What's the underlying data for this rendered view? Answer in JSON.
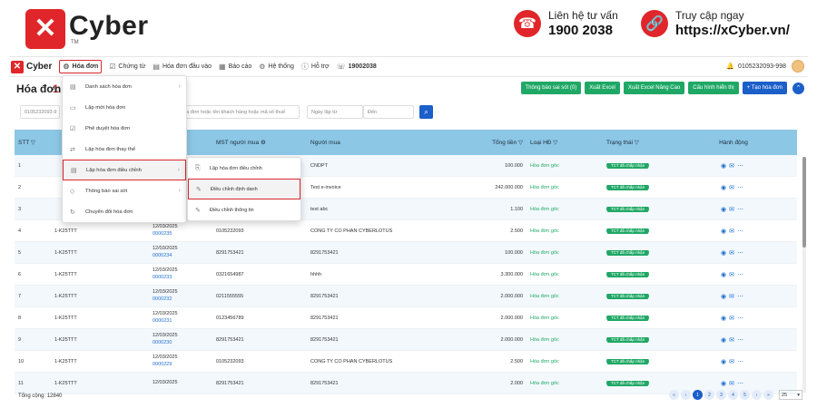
{
  "banner": {
    "brand": "Cyber",
    "tm": "TM",
    "hotline_label": "Liên hệ tư vấn",
    "hotline_number": "1900 2038",
    "site_label": "Truy cập ngay",
    "site_url": "https://xCyber.vn/"
  },
  "nav": {
    "brand": "Cyber",
    "items": [
      "Hóa đơn",
      "Chứng từ",
      "Hóa đơn đầu vào",
      "Báo cáo",
      "Hệ thống",
      "Hỗ trợ",
      "19002038"
    ],
    "account": "0105232093-998"
  },
  "markers": [
    "1",
    "2",
    "3"
  ],
  "page": {
    "title": "Hóa đơn",
    "tab": "cả",
    "buttons": [
      "Thông báo sai sót (0)",
      "Xuất Excel",
      "Xuất Excel Nâng Cao",
      "Cấu hình hiển thị",
      "+ Tạo hóa đơn"
    ]
  },
  "filters": {
    "tax_code": "0105232093-9",
    "search_placeholder": "hóa đơn hoặc tên khách hàng hoặc mã số thuế",
    "from_placeholder": "Ngày lập từ",
    "to_placeholder": "Đến"
  },
  "table": {
    "headers": [
      "STT",
      "",
      "lập",
      "MST người mua",
      "Người mua",
      "Tổng tiền",
      "Loại HĐ",
      "Trạng thái",
      "Hành động"
    ],
    "rows": [
      {
        "stt": "1",
        "kh": "",
        "date": "",
        "no": "",
        "mst": "",
        "buyer": "CNDPT",
        "total": "100.000",
        "type": "Hóa đơn gốc",
        "status": "TCT đã chấp nhận"
      },
      {
        "stt": "2",
        "kh": "",
        "date": "",
        "no": "",
        "mst": "",
        "buyer": "Test e-invoice",
        "total": "242.000.000",
        "type": "Hóa đơn gốc",
        "status": "TCT đã chấp nhận"
      },
      {
        "stt": "3",
        "kh": "",
        "date": "",
        "no": "",
        "mst": "",
        "buyer": "test abc",
        "total": "1.100",
        "type": "Hóa đơn gốc",
        "status": "TCT đã chấp nhận"
      },
      {
        "stt": "4",
        "kh": "1-K25TTT",
        "date": "12/03/2025",
        "no": "0000235",
        "mst": "0105232093",
        "buyer": "CÔNG TY CỔ PHẦN CYBERLOTUS",
        "total": "2.500",
        "type": "Hóa đơn gốc",
        "status": "TCT đã chấp nhận"
      },
      {
        "stt": "5",
        "kh": "1-K25TTT",
        "date": "12/03/2025",
        "no": "0000234",
        "mst": "8291753421",
        "buyer": "8291753421",
        "total": "100.000",
        "type": "Hóa đơn gốc",
        "status": "TCT đã chấp nhận"
      },
      {
        "stt": "6",
        "kh": "1-K25TTT",
        "date": "12/03/2025",
        "no": "0000233",
        "mst": "0321654987",
        "buyer": "hhhh",
        "total": "3.300.000",
        "type": "Hóa đơn gốc",
        "status": "TCT đã chấp nhận"
      },
      {
        "stt": "7",
        "kh": "1-K25TTT",
        "date": "12/03/2025",
        "no": "0000232",
        "mst": "0211555555",
        "buyer": "8291753421",
        "total": "2.000.000",
        "type": "Hóa đơn gốc",
        "status": "TCT đã chấp nhận"
      },
      {
        "stt": "8",
        "kh": "1-K25TTT",
        "date": "12/03/2025",
        "no": "0000231",
        "mst": "0123456789",
        "buyer": "8291753421",
        "total": "2.000.000",
        "type": "Hóa đơn gốc",
        "status": "TCT đã chấp nhận"
      },
      {
        "stt": "9",
        "kh": "1-K25TTT",
        "date": "12/03/2025",
        "no": "0000230",
        "mst": "8291753421",
        "buyer": "8291753421",
        "total": "2.000.000",
        "type": "Hóa đơn gốc",
        "status": "TCT đã chấp nhận"
      },
      {
        "stt": "10",
        "kh": "1-K25TTT",
        "date": "12/03/2025",
        "no": "0000229",
        "mst": "0105232093",
        "buyer": "CÔNG TY CỔ PHẦN CYBERLOTUS",
        "total": "2.500",
        "type": "Hóa đơn gốc",
        "status": "TCT đã chấp nhận"
      },
      {
        "stt": "11",
        "kh": "1-K25TTT",
        "date": "12/03/2025",
        "no": "",
        "mst": "8291753421",
        "buyer": "8291753421",
        "total": "2.000",
        "type": "Hóa đơn gốc",
        "status": "TCT đã chấp nhận"
      }
    ]
  },
  "menu": {
    "items": [
      "Danh sách hóa đơn",
      "Lập mới hóa đơn",
      "Phê duyệt hóa đơn",
      "Lập hóa đơn thay thế",
      "Lập hóa đơn điều chỉnh",
      "Thông báo sai sót",
      "Chuyển đổi hóa đơn"
    ]
  },
  "submenu": {
    "items": [
      "Lập hóa đơn điều chỉnh",
      "Điều chỉnh định danh",
      "Điều chỉnh thông tin"
    ]
  },
  "footer": {
    "total": "Tổng cộng: 12840",
    "pages": [
      "«",
      "‹",
      "1",
      "2",
      "3",
      "4",
      "5",
      "›",
      "»"
    ],
    "page_size": "25"
  },
  "colors": {
    "brand_red": "#e0262a",
    "accent_blue": "#1b5fc9",
    "success_green": "#1fa865",
    "table_header": "#8cc7e6",
    "highlight": "#d9272e"
  }
}
